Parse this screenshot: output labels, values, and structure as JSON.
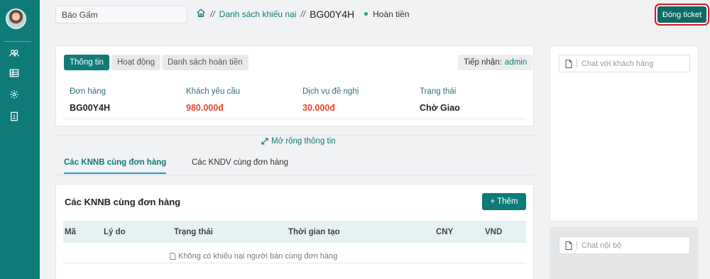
{
  "sidebar": {
    "items": [
      {
        "icon": "users-icon"
      },
      {
        "icon": "table-icon"
      },
      {
        "icon": "gear-icon"
      },
      {
        "icon": "document-icon"
      }
    ]
  },
  "header": {
    "search_value": "Báo Gấm",
    "breadcrumb_link": "Danh sách khiếu nại",
    "breadcrumb_sep": "//",
    "ticket_code": "BG00Y4H",
    "status": "Hoàn tiền",
    "close_button": "Đóng ticket"
  },
  "info": {
    "tabs": [
      "Thông tin",
      "Hoạt động",
      "Danh sách hoàn tiền"
    ],
    "receiver_label": "Tiếp nhận:",
    "receiver_name": "admin",
    "fields": [
      {
        "label": "Đơn hàng",
        "value": "BG00Y4H"
      },
      {
        "label": "Khách yêu cầu",
        "value": "980.000đ"
      },
      {
        "label": "Dịch vụ đề nghị",
        "value": "30.000đ"
      },
      {
        "label": "Trạng thái",
        "value": "Chờ Giao"
      }
    ],
    "expand_label": "Mở rộng thông tin"
  },
  "sub_tabs": [
    "Các KNNB cùng đơn hàng",
    "Các KNDV cùng đơn hàng"
  ],
  "list": {
    "title": "Các KNNB cùng đơn hàng",
    "add_button": "+ Thêm",
    "columns": [
      "Mã",
      "Lý do",
      "Trạng thái",
      "Thời gian tạo",
      "CNY",
      "VND"
    ],
    "empty_text": "Không có khiếu nại người bán cùng đơn hàng"
  },
  "chat": {
    "customer_placeholder": "Chat với khách hàng",
    "internal_placeholder": "Chat nội bộ"
  },
  "colors": {
    "primary": "#0e7b78",
    "accent_red": "#e8452c",
    "status_dot": "#22a35a",
    "highlight": "#e0141c"
  }
}
